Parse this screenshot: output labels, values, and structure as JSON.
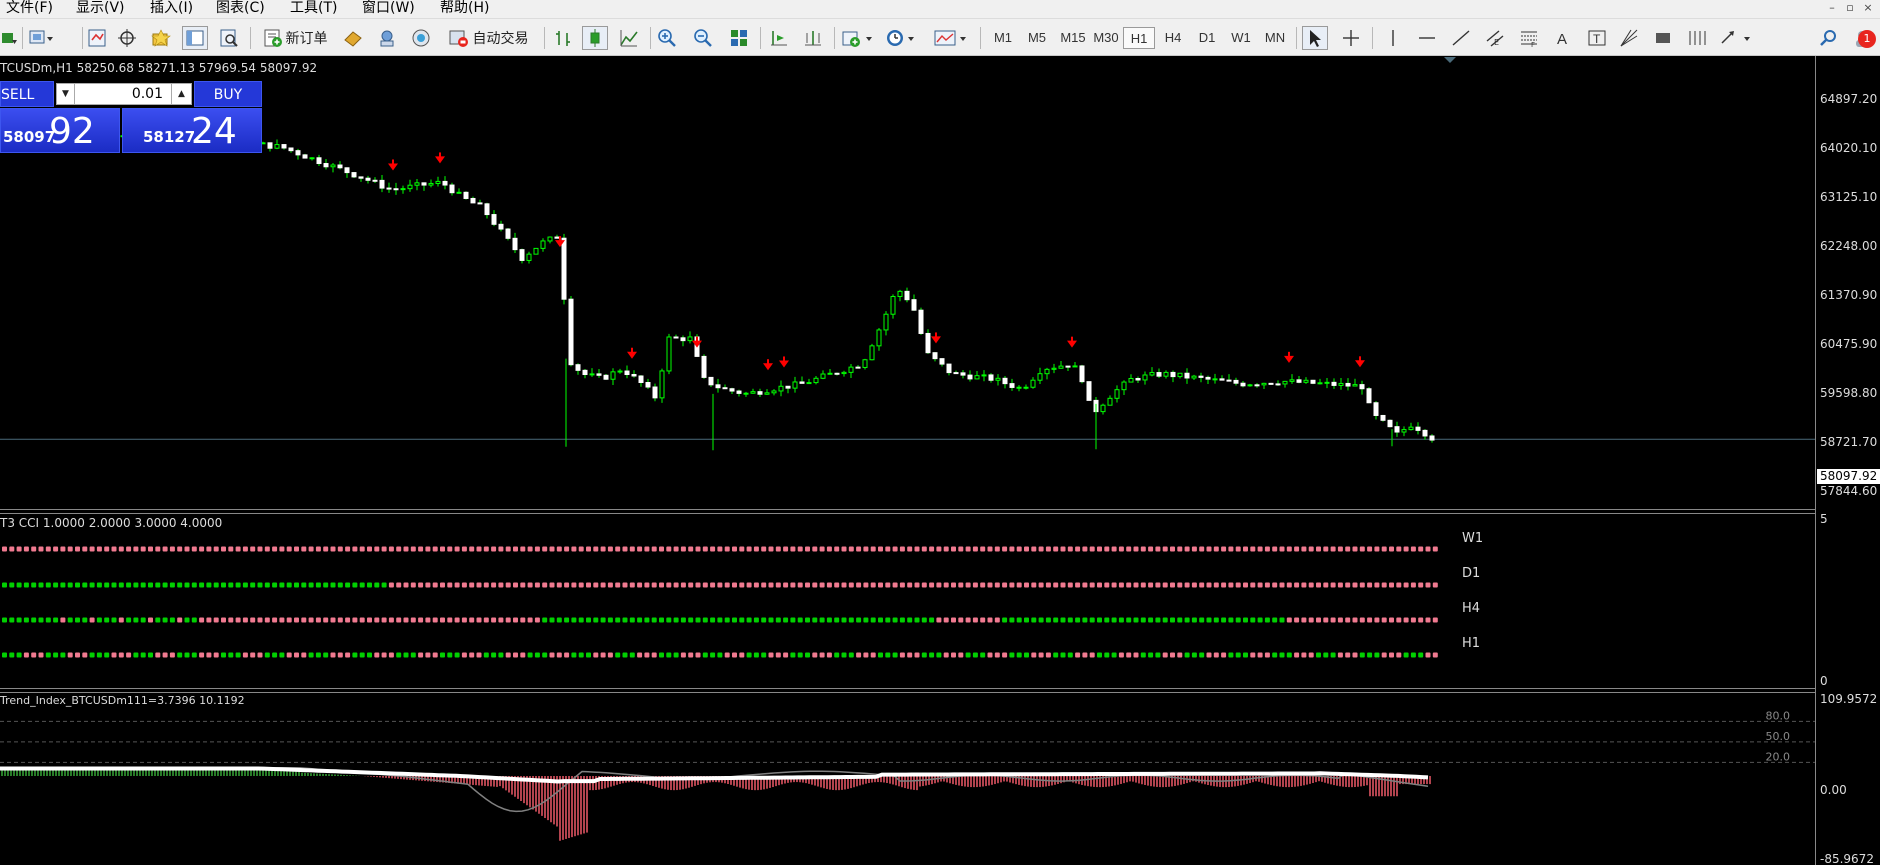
{
  "menu": {
    "items": [
      "文件(F)",
      "显示(V)",
      "插入(I)",
      "图表(C)",
      "工具(T)",
      "窗口(W)",
      "帮助(H)"
    ]
  },
  "toolbar": {
    "new_order": "新订单",
    "auto_trading": "自动交易",
    "timeframes": [
      "M1",
      "M5",
      "M15",
      "M30",
      "H1",
      "H4",
      "D1",
      "W1",
      "MN"
    ],
    "active_timeframe": "H1",
    "notification_count": "1"
  },
  "chart": {
    "title": "TCUSDm,H1  58250.68 58271.13 57969.54 58097.92",
    "symbol": "BTCUSDm",
    "timeframe": "H1",
    "ohlc": [
      58250.68,
      58271.13,
      57969.54,
      58097.92
    ],
    "current_price": "58097.92",
    "price_levels": [
      "64897.20",
      "64020.10",
      "63125.10",
      "62248.00",
      "61370.90",
      "60475.90",
      "59598.80",
      "58721.70",
      "57844.60"
    ],
    "colors": {
      "bull": "#00ff00",
      "bear": "#ffffff",
      "arrow": "#ff0000",
      "price_line": "#4a6a7a"
    }
  },
  "trade_panel": {
    "sell_label": "SELL",
    "buy_label": "BUY",
    "lot": "0.01",
    "sell_price_prefix": "58097",
    "sell_price_big": "92",
    "buy_price_prefix": "58127",
    "buy_price_big": "24"
  },
  "cci_indicator": {
    "title": "T3 CCI 1.0000 2.0000 3.0000 4.0000",
    "scale_top": "5",
    "scale_bottom": "0",
    "rows": [
      {
        "label": "W1"
      },
      {
        "label": "D1"
      },
      {
        "label": "H4"
      },
      {
        "label": "H1"
      }
    ],
    "colors": {
      "up": "#00d000",
      "down": "#f07a90"
    }
  },
  "trend_index": {
    "title": "Trend_Index_BTCUSDm111=3.7396 10.1192",
    "scale_top": "109.9572",
    "scale_zero": "0.00",
    "scale_bottom": "-85.9672",
    "levels": [
      "80.0",
      "50.0",
      "20.0"
    ],
    "colors": {
      "positive": "#3bb33b",
      "negative": "#ff6070",
      "line": "#ffffff",
      "signal": "#808080"
    }
  }
}
